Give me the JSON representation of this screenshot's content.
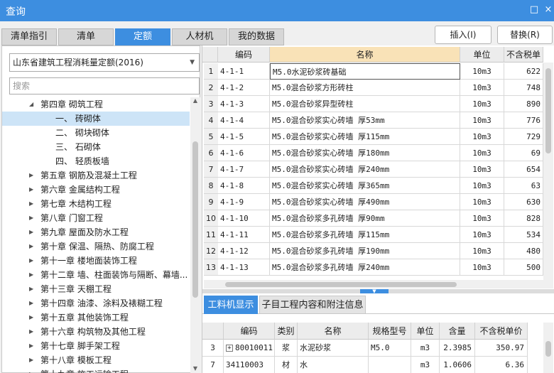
{
  "window": {
    "title": "查询",
    "maximize_icon": "□",
    "close_icon": "×"
  },
  "tabs": [
    "清单指引",
    "清单",
    "定额",
    "人材机",
    "我的数据"
  ],
  "active_tab": 2,
  "buttons": {
    "insert": "插入(I)",
    "replace": "替换(R)"
  },
  "left": {
    "quota_select": "山东省建筑工程消耗量定额(2016)",
    "search_placeholder": "搜索",
    "tree": [
      {
        "label": "第四章 砌筑工程",
        "level": 0,
        "expanded": true
      },
      {
        "label": "一、  砖砌体",
        "level": 1,
        "selected": true
      },
      {
        "label": "二、  砌块砌体",
        "level": 1
      },
      {
        "label": "三、  石砌体",
        "level": 1
      },
      {
        "label": "四、  轻质板墙",
        "level": 1
      },
      {
        "label": "第五章 钢筋及混凝土工程",
        "level": 0
      },
      {
        "label": "第六章 金属结构工程",
        "level": 0
      },
      {
        "label": "第七章 木结构工程",
        "level": 0
      },
      {
        "label": "第八章 门窗工程",
        "level": 0
      },
      {
        "label": "第九章 屋面及防水工程",
        "level": 0
      },
      {
        "label": "第十章 保温、隔热、防腐工程",
        "level": 0
      },
      {
        "label": "第十一章 楼地面装饰工程",
        "level": 0
      },
      {
        "label": "第十二章 墙、柱面装饰与隔断、幕墙...",
        "level": 0
      },
      {
        "label": "第十三章 天棚工程",
        "level": 0
      },
      {
        "label": "第十四章 油漆、涂料及裱糊工程",
        "level": 0
      },
      {
        "label": "第十五章 其他装饰工程",
        "level": 0
      },
      {
        "label": "第十六章 构筑物及其他工程",
        "level": 0
      },
      {
        "label": "第十七章 脚手架工程",
        "level": 0
      },
      {
        "label": "第十八章 模板工程",
        "level": 0
      },
      {
        "label": "第十九章 施工运输工程",
        "level": 0
      }
    ]
  },
  "grid": {
    "headers": [
      "编码",
      "名称",
      "单位",
      "不含税单"
    ],
    "rows": [
      {
        "n": "1",
        "code": "4-1-1",
        "name": "M5.0水泥砂浆砖基础",
        "unit": "10m3",
        "price": "622"
      },
      {
        "n": "2",
        "code": "4-1-2",
        "name": "M5.0混合砂浆方形砖柱",
        "unit": "10m3",
        "price": "748"
      },
      {
        "n": "3",
        "code": "4-1-3",
        "name": "M5.0混合砂浆异型砖柱",
        "unit": "10m3",
        "price": "890"
      },
      {
        "n": "4",
        "code": "4-1-4",
        "name": "M5.0混合砂浆实心砖墙 厚53mm",
        "unit": "10m3",
        "price": "776"
      },
      {
        "n": "5",
        "code": "4-1-5",
        "name": "M5.0混合砂浆实心砖墙 厚115mm",
        "unit": "10m3",
        "price": "729"
      },
      {
        "n": "6",
        "code": "4-1-6",
        "name": "M5.0混合砂浆实心砖墙 厚180mm",
        "unit": "10m3",
        "price": "69"
      },
      {
        "n": "7",
        "code": "4-1-7",
        "name": "M5.0混合砂浆实心砖墙 厚240mm",
        "unit": "10m3",
        "price": "654"
      },
      {
        "n": "8",
        "code": "4-1-8",
        "name": "M5.0混合砂浆实心砖墙 厚365mm",
        "unit": "10m3",
        "price": "63"
      },
      {
        "n": "9",
        "code": "4-1-9",
        "name": "M5.0混合砂浆实心砖墙 厚490mm",
        "unit": "10m3",
        "price": "630"
      },
      {
        "n": "10",
        "code": "4-1-10",
        "name": "M5.0混合砂浆多孔砖墙 厚90mm",
        "unit": "10m3",
        "price": "828"
      },
      {
        "n": "11",
        "code": "4-1-11",
        "name": "M5.0混合砂浆多孔砖墙 厚115mm",
        "unit": "10m3",
        "price": "534"
      },
      {
        "n": "12",
        "code": "4-1-12",
        "name": "M5.0混合砂浆多孔砖墙 厚190mm",
        "unit": "10m3",
        "price": "480"
      },
      {
        "n": "13",
        "code": "4-1-13",
        "name": "M5.0混合砂浆多孔砖墙 厚240mm",
        "unit": "10m3",
        "price": "500"
      }
    ]
  },
  "subtabs": [
    "工料机显示",
    "子目工程内容和附注信息"
  ],
  "bottom": {
    "headers": [
      "编码",
      "类别",
      "名称",
      "规格型号",
      "单位",
      "含量",
      "不含税单价"
    ],
    "rows": [
      {
        "n": "3",
        "expand": "+",
        "code": "80010011",
        "cat": "浆",
        "name": "水泥砂浆",
        "spec": "M5.0",
        "unit": "m3",
        "qty": "2.3985",
        "price": "350.97"
      },
      {
        "n": "7",
        "expand": "",
        "code": "34110003",
        "cat": "材",
        "name": "水",
        "spec": "",
        "unit": "m3",
        "qty": "1.0606",
        "price": "6.36"
      }
    ]
  }
}
